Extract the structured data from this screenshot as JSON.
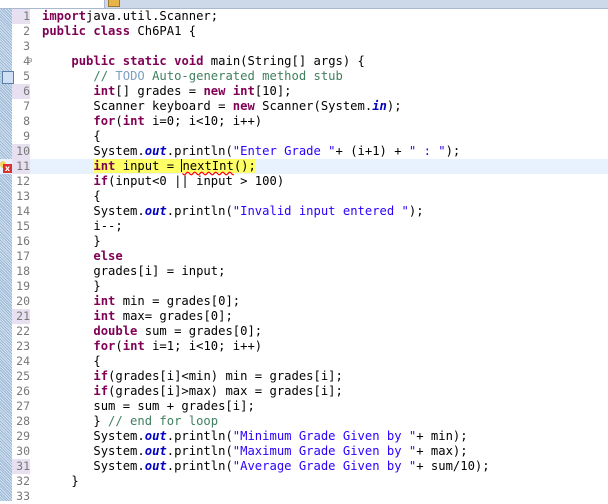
{
  "editor": {
    "file_class": "Ch6PA1",
    "current_line": 11,
    "lines": [
      {
        "n": "1",
        "tokens": [
          [
            "kw",
            "import"
          ],
          [
            "",
            "java.util.Scanner;"
          ]
        ]
      },
      {
        "n": "2",
        "tokens": [
          [
            "kw",
            "public"
          ],
          [
            "",
            " "
          ],
          [
            "kw",
            "class"
          ],
          [
            "",
            " Ch6PA1 {"
          ]
        ]
      },
      {
        "n": "3",
        "tokens": []
      },
      {
        "n": "4",
        "tokens": [
          [
            "",
            "    "
          ],
          [
            "kw",
            "public"
          ],
          [
            "",
            " "
          ],
          [
            "kw",
            "static"
          ],
          [
            "",
            " "
          ],
          [
            "kw",
            "void"
          ],
          [
            "",
            " main(String[] args) {"
          ]
        ]
      },
      {
        "n": "5",
        "tokens": [
          [
            "",
            "       "
          ],
          [
            "cm",
            "// "
          ],
          [
            "tg",
            "TODO"
          ],
          [
            "cm",
            " Auto-generated method stub"
          ]
        ]
      },
      {
        "n": "6",
        "tokens": [
          [
            "",
            "       "
          ],
          [
            "kw",
            "int"
          ],
          [
            "",
            "[] grades = "
          ],
          [
            "kw",
            "new"
          ],
          [
            "",
            " "
          ],
          [
            "kw",
            "int"
          ],
          [
            "",
            "[10];"
          ]
        ]
      },
      {
        "n": "7",
        "tokens": [
          [
            "",
            "       Scanner keyboard = "
          ],
          [
            "kw",
            "new"
          ],
          [
            "",
            " Scanner(System."
          ],
          [
            "fld",
            "in"
          ],
          [
            "",
            ");"
          ]
        ]
      },
      {
        "n": "8",
        "tokens": [
          [
            "",
            "       "
          ],
          [
            "kw",
            "for"
          ],
          [
            "",
            "("
          ],
          [
            "kw",
            "int"
          ],
          [
            "",
            " i=0; i<10; i++)"
          ]
        ]
      },
      {
        "n": "9",
        "tokens": [
          [
            "",
            "       {"
          ]
        ]
      },
      {
        "n": "10",
        "tokens": [
          [
            "",
            "       System."
          ],
          [
            "fld",
            "out"
          ],
          [
            "",
            ".println("
          ],
          [
            "st",
            "\"Enter Grade \""
          ],
          [
            "",
            "+ (i+1) + "
          ],
          [
            "st",
            "\" : \""
          ],
          [
            "",
            ");"
          ]
        ]
      },
      {
        "n": "11",
        "tokens": [
          [
            "",
            "       "
          ],
          [
            "hlkw",
            "int"
          ],
          [
            "hl",
            " input = "
          ],
          [
            "caret",
            ""
          ],
          [
            "hlerr",
            "nextInt"
          ],
          [
            "hl",
            "();"
          ]
        ]
      },
      {
        "n": "12",
        "tokens": [
          [
            "",
            "       "
          ],
          [
            "kw",
            "if"
          ],
          [
            "",
            "(input<0 || input > 100)"
          ]
        ]
      },
      {
        "n": "13",
        "tokens": [
          [
            "",
            "       {"
          ]
        ]
      },
      {
        "n": "14",
        "tokens": [
          [
            "",
            "       System."
          ],
          [
            "fld",
            "out"
          ],
          [
            "",
            ".println("
          ],
          [
            "st",
            "\"Invalid input entered \""
          ],
          [
            "",
            ");"
          ]
        ]
      },
      {
        "n": "15",
        "tokens": [
          [
            "",
            "       i--;"
          ]
        ]
      },
      {
        "n": "16",
        "tokens": [
          [
            "",
            "       }"
          ]
        ]
      },
      {
        "n": "17",
        "tokens": [
          [
            "",
            "       "
          ],
          [
            "kw",
            "else"
          ]
        ]
      },
      {
        "n": "18",
        "tokens": [
          [
            "",
            "       grades[i] = input;"
          ]
        ]
      },
      {
        "n": "19",
        "tokens": [
          [
            "",
            "       }"
          ]
        ]
      },
      {
        "n": "20",
        "tokens": [
          [
            "",
            "       "
          ],
          [
            "kw",
            "int"
          ],
          [
            "",
            " min = grades[0];"
          ]
        ]
      },
      {
        "n": "21",
        "tokens": [
          [
            "",
            "       "
          ],
          [
            "kw",
            "int"
          ],
          [
            "",
            " max= grades[0];"
          ]
        ]
      },
      {
        "n": "22",
        "tokens": [
          [
            "",
            "       "
          ],
          [
            "kw",
            "double"
          ],
          [
            "",
            " sum = grades[0];"
          ]
        ]
      },
      {
        "n": "23",
        "tokens": [
          [
            "",
            "       "
          ],
          [
            "kw",
            "for"
          ],
          [
            "",
            "("
          ],
          [
            "kw",
            "int"
          ],
          [
            "",
            " i=1; i<10; i++)"
          ]
        ]
      },
      {
        "n": "24",
        "tokens": [
          [
            "",
            "       {"
          ]
        ]
      },
      {
        "n": "25",
        "tokens": [
          [
            "",
            "       "
          ],
          [
            "kw",
            "if"
          ],
          [
            "",
            "(grades[i]<min) min = grades[i];"
          ]
        ]
      },
      {
        "n": "26",
        "tokens": [
          [
            "",
            "       "
          ],
          [
            "kw",
            "if"
          ],
          [
            "",
            "(grades[i]>max) max = grades[i];"
          ]
        ]
      },
      {
        "n": "27",
        "tokens": [
          [
            "",
            "       sum = sum + grades[i];"
          ]
        ]
      },
      {
        "n": "28",
        "tokens": [
          [
            "",
            "       } "
          ],
          [
            "cm",
            "// end for loop"
          ]
        ]
      },
      {
        "n": "29",
        "tokens": [
          [
            "",
            "       System."
          ],
          [
            "fld",
            "out"
          ],
          [
            "",
            ".println("
          ],
          [
            "st",
            "\"Minimum Grade Given by \""
          ],
          [
            "",
            "+ min);"
          ]
        ]
      },
      {
        "n": "30",
        "tokens": [
          [
            "",
            "       System."
          ],
          [
            "fld",
            "out"
          ],
          [
            "",
            ".println("
          ],
          [
            "st",
            "\"Maximum Grade Given by \""
          ],
          [
            "",
            "+ max);"
          ]
        ]
      },
      {
        "n": "31",
        "tokens": [
          [
            "",
            "       System."
          ],
          [
            "fld",
            "out"
          ],
          [
            "",
            ".println("
          ],
          [
            "st",
            "\"Average Grade Given by \""
          ],
          [
            "",
            "+ sum/10);"
          ]
        ]
      },
      {
        "n": "32",
        "tokens": [
          [
            "",
            "    }"
          ]
        ]
      },
      {
        "n": "33",
        "tokens": []
      }
    ],
    "marked_lines": [
      "1",
      "6",
      "10",
      "11",
      "21",
      "31"
    ],
    "fold_marker_line": "4",
    "task_marker_line": "5",
    "error_marker_line": "11",
    "error_icon_glyph": "x",
    "fold_glyph": "⊖"
  }
}
